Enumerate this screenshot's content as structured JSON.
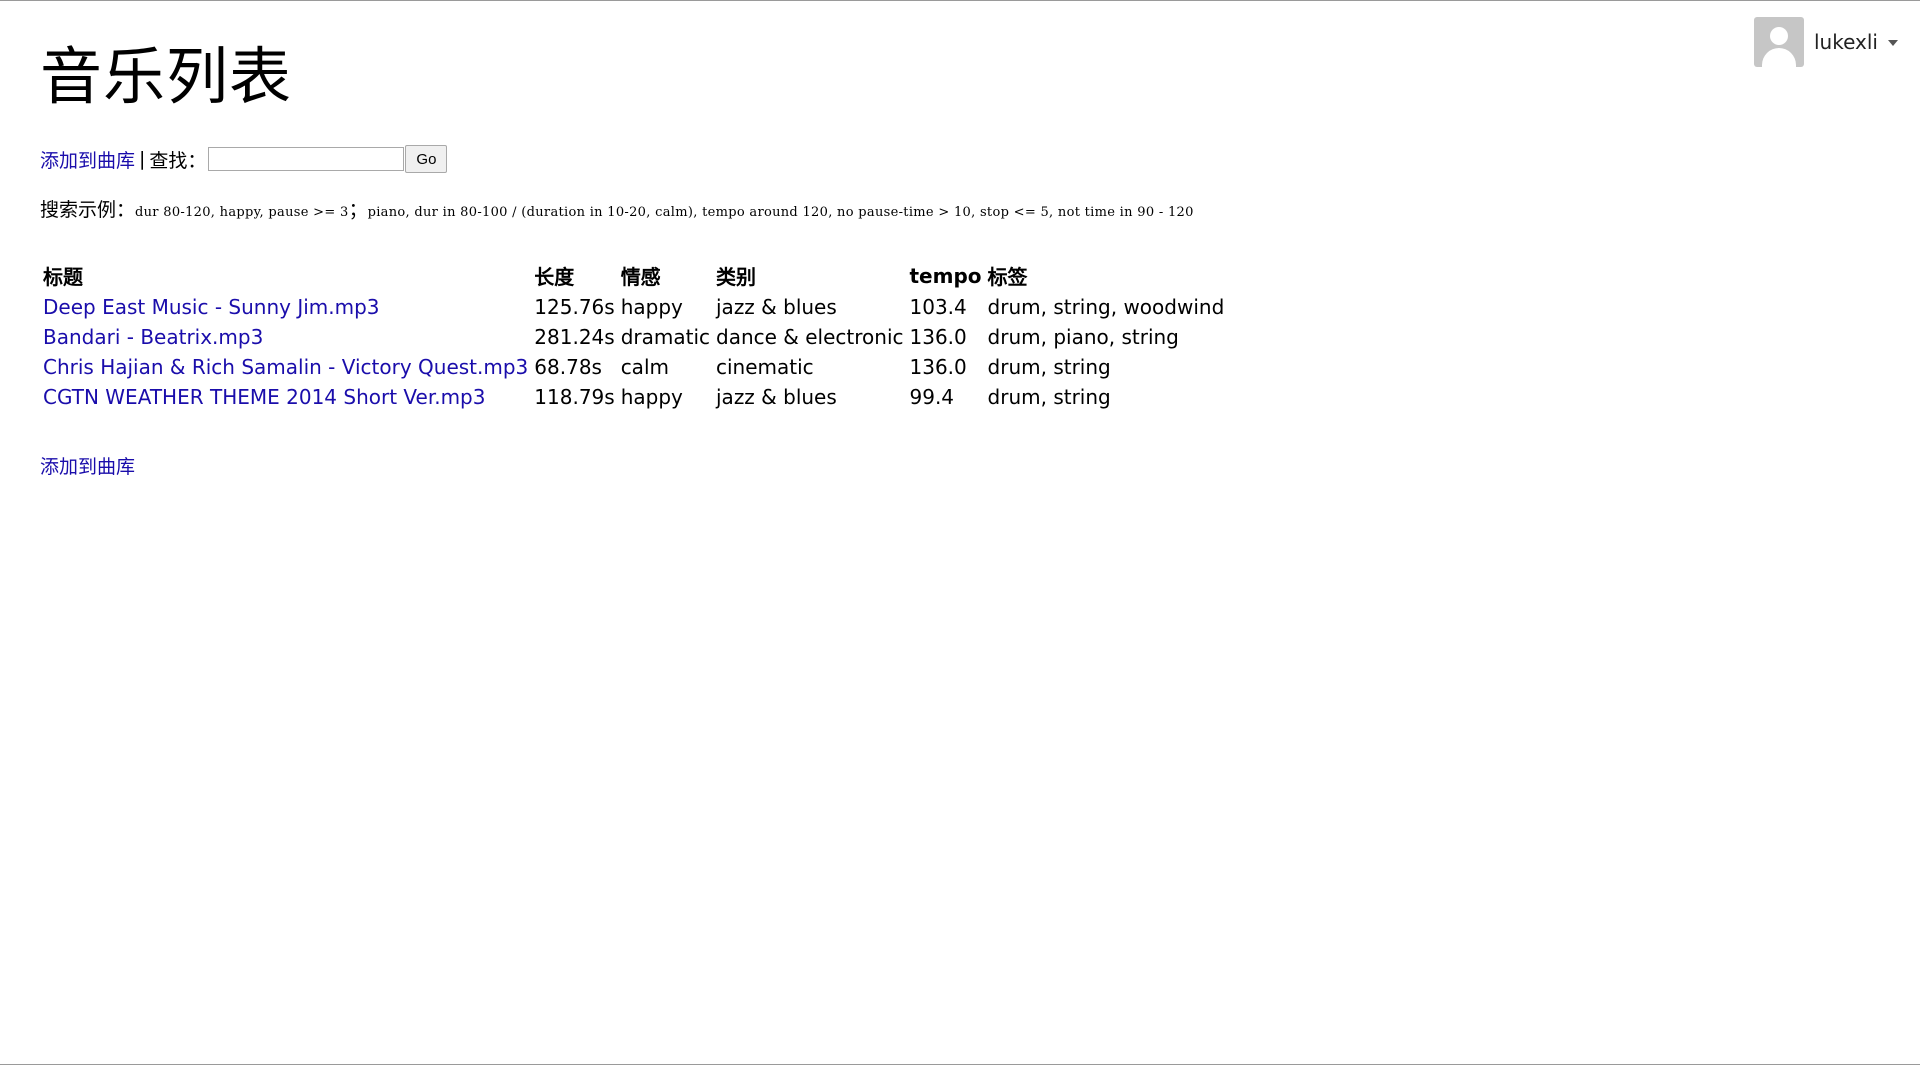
{
  "page": {
    "title": "音乐列表"
  },
  "user": {
    "name": "lukexli",
    "avatar_icon": "user-avatar-icon",
    "menu_icon": "caret-down-icon"
  },
  "toolbar": {
    "add_link": "添加到曲库",
    "separator": "|",
    "search_label": "查找：",
    "search_value": "",
    "search_placeholder": "",
    "go_button": "Go"
  },
  "examples": {
    "label": "搜索示例：",
    "part1": "dur 80-120, happy, pause >= 3",
    "divider": "；",
    "part2": "piano, dur in 80-100 / (duration in 10-20, calm), tempo around 120, no pause-time > 10, stop <= 5, not time in 90 - 120"
  },
  "table": {
    "headers": {
      "title": "标题",
      "length": "长度",
      "emotion": "情感",
      "category": "类别",
      "tempo": "tempo",
      "tags": "标签"
    },
    "rows": [
      {
        "title": "Deep East Music - Sunny Jim.mp3",
        "length": "125.76s",
        "emotion": "happy",
        "category": "jazz & blues",
        "tempo": "103.4",
        "tags": "drum, string, woodwind"
      },
      {
        "title": "Bandari - Beatrix.mp3",
        "length": "281.24s",
        "emotion": "dramatic",
        "category": "dance & electronic",
        "tempo": "136.0",
        "tags": "drum, piano, string"
      },
      {
        "title": "Chris Hajian & Rich Samalin - Victory Quest.mp3",
        "length": "68.78s",
        "emotion": "calm",
        "category": "cinematic",
        "tempo": "136.0",
        "tags": "drum, string"
      },
      {
        "title": "CGTN WEATHER THEME 2014 Short Ver.mp3",
        "length": "118.79s",
        "emotion": "happy",
        "category": "jazz & blues",
        "tempo": "99.4",
        "tags": "drum, string"
      }
    ]
  },
  "footer": {
    "add_link": "添加到曲库"
  },
  "colors": {
    "link": "#1a0dab",
    "text": "#000000",
    "avatar_bg": "#c6c6c6"
  }
}
